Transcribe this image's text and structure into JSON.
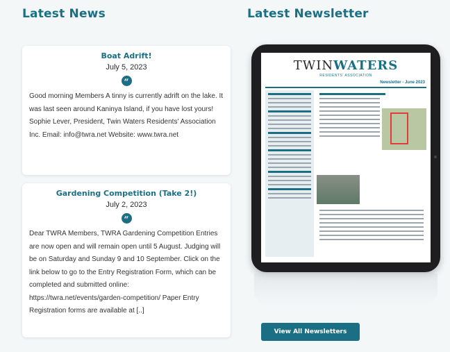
{
  "news": {
    "heading": "Latest News",
    "items": [
      {
        "title": "Boat Adrift!",
        "date": "July 5, 2023",
        "excerpt": "Good morning Members A tinny is currently adrift on the lake.  It was last seen around Kaninya Island, if you have lost yours! Sophie Lever, President, Twin Waters Residents' Association Inc. Email: info@twra.net Website: www.twra.net"
      },
      {
        "title": "Gardening Competition (Take 2!)",
        "date": "July 2, 2023",
        "excerpt": "Dear TWRA Members, TWRA Gardening Competition Entries are now open and will remain open until 5 August.  Judging will be on Saturday and Sunday 9 and 10 September.  Click on the link below to go to the Entry Registration Form, which can be completed and submitted online: https://twra.net/events/garden-competition/ Paper Entry Registration forms are available at [..]"
      }
    ]
  },
  "newsletter": {
    "heading": "Latest Newsletter",
    "brand_part1": "TWIN",
    "brand_part2": "WATERS",
    "brand_sub": "RESIDENTS' ASSOCIATION",
    "issue": "Newsletter - June 2023",
    "button_label": "View All Newsletters"
  },
  "icons": {
    "quote": "quote-icon"
  },
  "colors": {
    "accent": "#1b6f84",
    "background": "#f3f7f8"
  }
}
